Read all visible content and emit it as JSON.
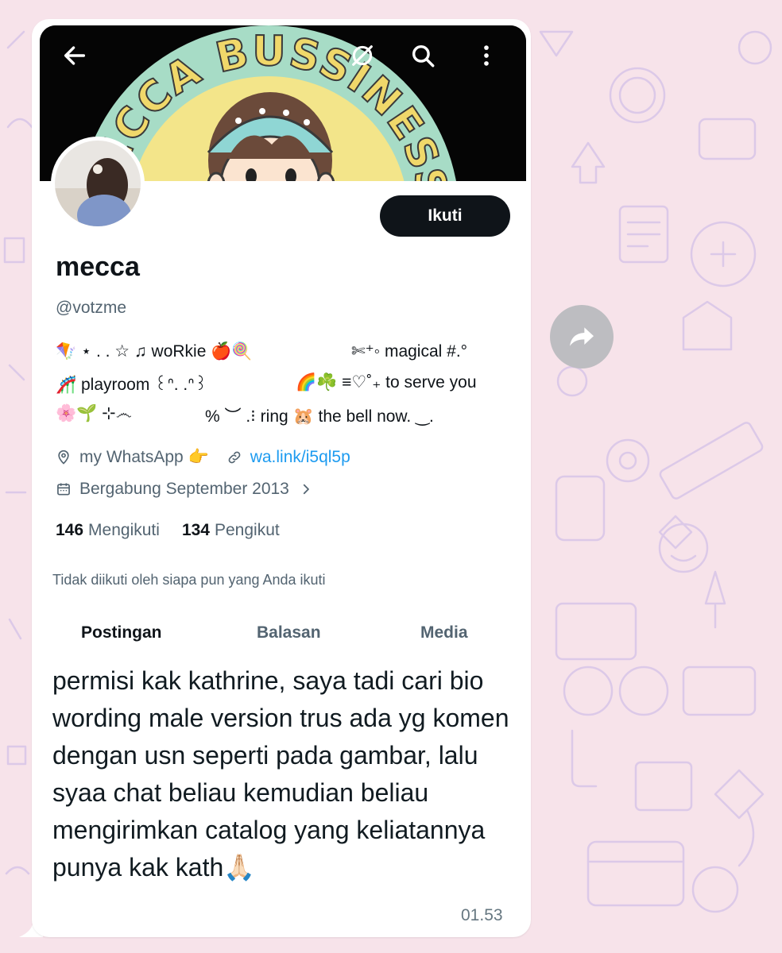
{
  "colors": {
    "wallpaper": "#f7e3ea",
    "doodle": "#d8c6e6",
    "bubble": "#ffffff",
    "follow_button": "#0f1419",
    "link": "#1d9bf0",
    "muted_text": "#536471",
    "timestamp": "#667781"
  },
  "banner": {
    "arc_text": "MECCA BUSSINESS",
    "icons": [
      "arrow-left-icon",
      "translate-icon",
      "search-icon",
      "more-vertical-icon"
    ]
  },
  "profile": {
    "name": "mecca",
    "handle": "@votzme",
    "follow_label": "Ikuti",
    "bio": {
      "line1_left": "🪁 ⋆ . . ☆ ♫ woRkie 🍎🍭",
      "line1_right": "✄⁺◦ magical #.°",
      "line2_left": "🎢 playroom ꒰ᐢ. .ᐢ꒱",
      "line2_right": "🌈☘️ ≡♡˚₊ to serve you",
      "line3_left": "🌸🌱 ⊹෴",
      "line3_right": "% ︶ .⁝ ring 🐹 the bell now. ‿."
    },
    "location": "my WhatsApp 👉",
    "link": "wa.link/i5ql5p",
    "joined": "Bergabung September 2013",
    "following_count": "146",
    "following_label": "Mengikuti",
    "followers_count": "134",
    "followers_label": "Pengikut",
    "not_followed_note": "Tidak diikuti oleh siapa pun yang Anda ikuti"
  },
  "tabs": [
    {
      "label": "Postingan",
      "active": true
    },
    {
      "label": "Balasan",
      "active": false
    },
    {
      "label": "Media",
      "active": false
    }
  ],
  "message": {
    "text": "permisi kak kathrine, saya tadi cari bio wording male version trus ada yg komen dengan usn seperti pada gambar, lalu syaa chat beliau kemudian beliau mengirimkan catalog yang keliatannya punya kak kath🙏🏻",
    "time": "01.53"
  },
  "forward_icon": "share-forward-icon"
}
